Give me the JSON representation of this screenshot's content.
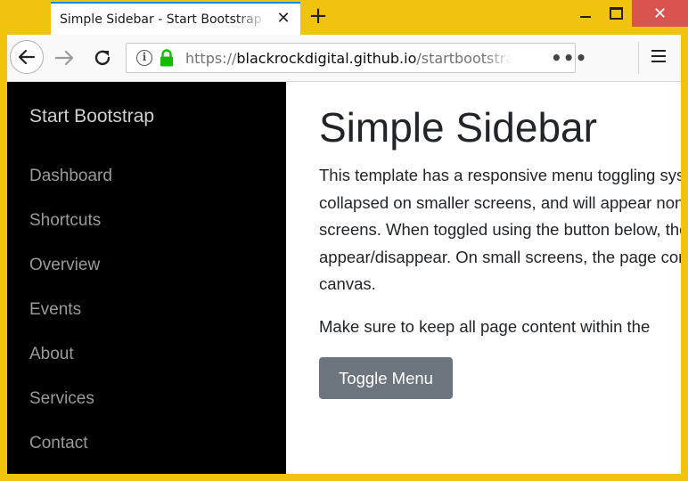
{
  "browser": {
    "tab_title": "Simple Sidebar - Start Bootstrap Template",
    "tab_close": "✕",
    "new_tab": "+",
    "url_prefix": "https://",
    "url_domain": "blackrockdigital.github.io",
    "url_path": "/startbootstrap-simple-sidebar/",
    "page_actions": "•••",
    "window_close": "✕"
  },
  "sidebar": {
    "brand": "Start Bootstrap",
    "items": [
      {
        "label": "Dashboard"
      },
      {
        "label": "Shortcuts"
      },
      {
        "label": "Overview"
      },
      {
        "label": "Events"
      },
      {
        "label": "About"
      },
      {
        "label": "Services"
      },
      {
        "label": "Contact"
      }
    ]
  },
  "main": {
    "title": "Simple Sidebar",
    "paragraph1_lines": [
      "This template has a responsive menu toggling system. The menu will appear",
      "collapsed on smaller screens, and will appear non-collapsed on larger",
      "screens. When toggled using the button below, the menu will",
      "appear/disappear. On small screens, the page content will be pushed off",
      "canvas."
    ],
    "paragraph2": "Make sure to keep all page content within the",
    "toggle_button": "Toggle Menu"
  },
  "colors": {
    "window_frame": "#f0c30f",
    "sidebar_bg": "#000000",
    "button_bg": "#6c757d",
    "close_bg": "#d9534f",
    "lock_green": "#12bc00"
  }
}
